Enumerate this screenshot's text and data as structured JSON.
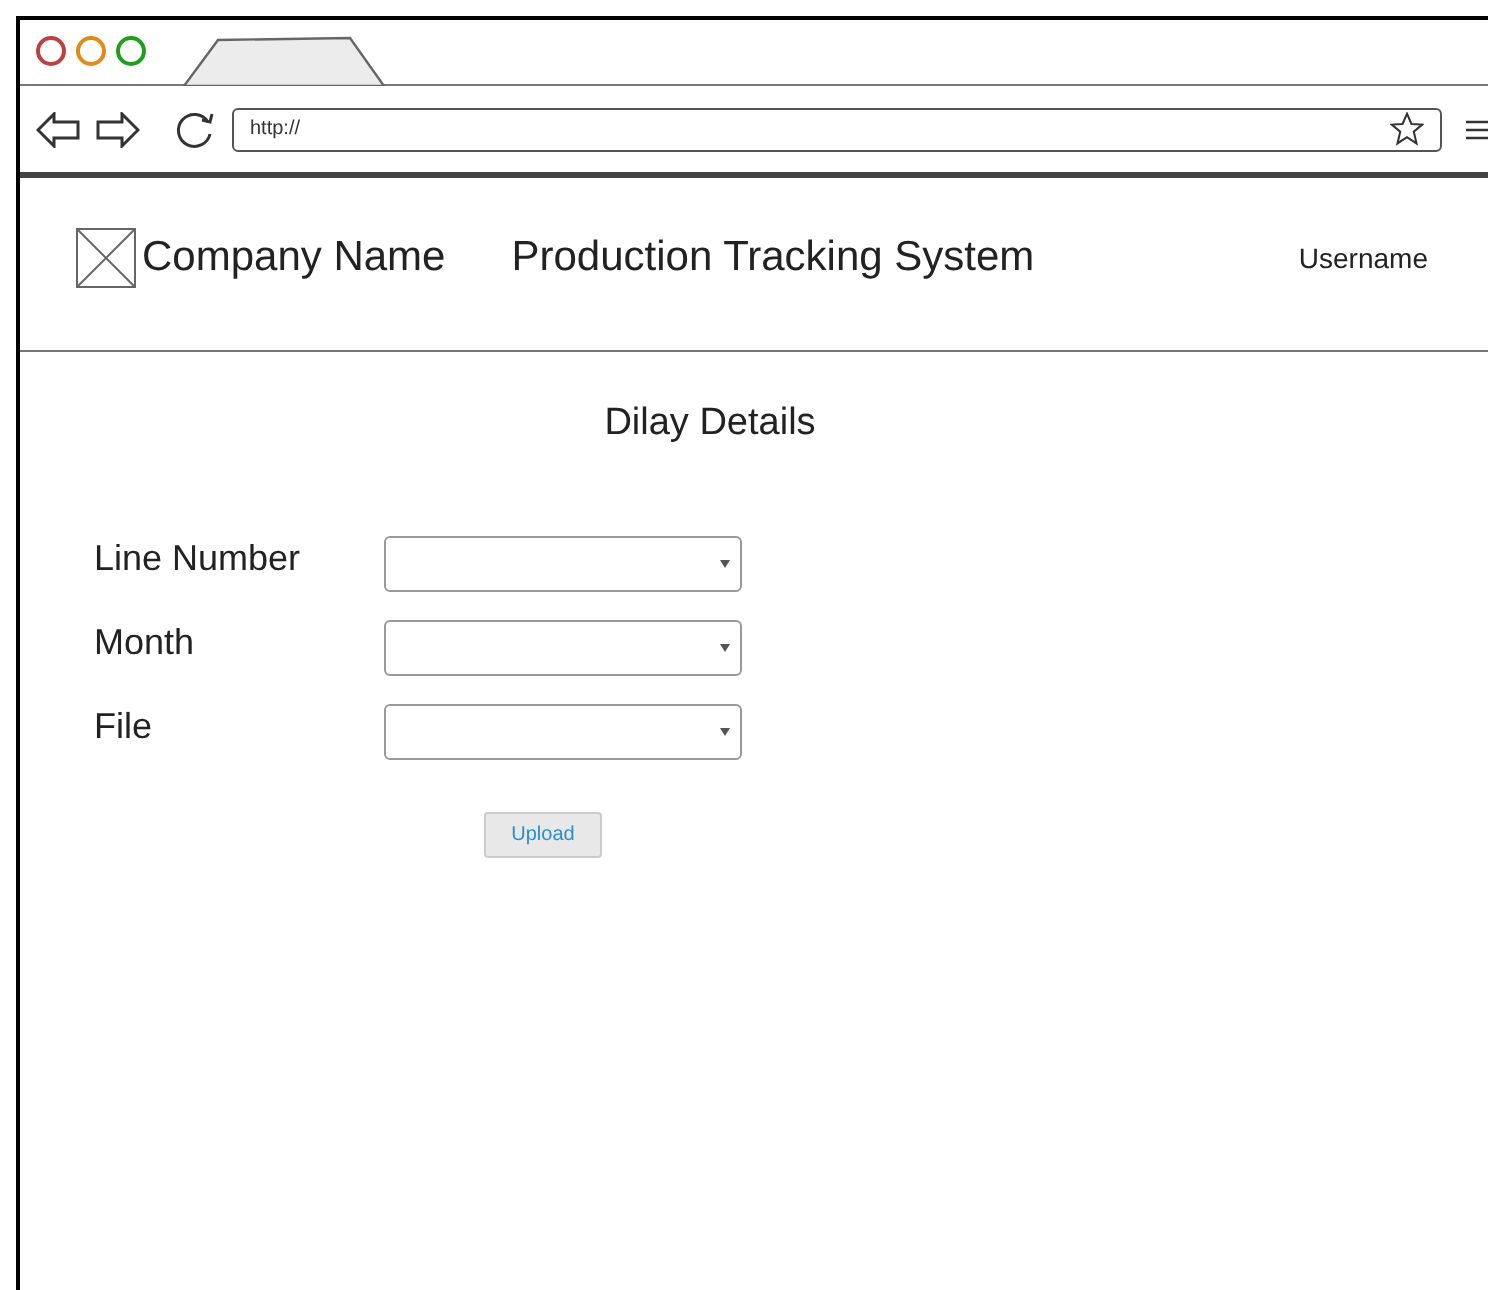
{
  "browser": {
    "url": "http://"
  },
  "header": {
    "company": "Company Name",
    "app_title": "Production Tracking System",
    "username": "Username"
  },
  "page_title": "Dilay Details",
  "form": {
    "fields": [
      {
        "label": "Line Number"
      },
      {
        "label": "Month"
      },
      {
        "label": "File"
      }
    ],
    "button": "Upload"
  }
}
